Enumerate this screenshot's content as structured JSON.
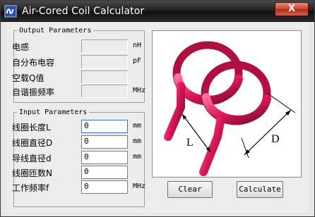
{
  "window": {
    "title": "Air-Cored Coil Calculator",
    "close_label": "X"
  },
  "output": {
    "legend": "Output Parameters",
    "rows": [
      {
        "label": "电感",
        "value": "",
        "unit": "nH"
      },
      {
        "label": "自分布电容",
        "value": "",
        "unit": "pF"
      },
      {
        "label": "空载Q值",
        "value": "",
        "unit": ""
      },
      {
        "label": "自谐振频率",
        "value": "",
        "unit": "MHz"
      }
    ]
  },
  "input": {
    "legend": "Input Parameters",
    "rows": [
      {
        "label": "线圈长度L",
        "value": "0",
        "unit": "mm"
      },
      {
        "label": "线圈直径D",
        "value": "0",
        "unit": "mm"
      },
      {
        "label": "导线直径d",
        "value": "0",
        "unit": "mm"
      },
      {
        "label": "线圈匝数N",
        "value": "0",
        "unit": ""
      },
      {
        "label": "工作频率f",
        "value": "0",
        "unit": "MHz"
      }
    ]
  },
  "diagram": {
    "label_L": "L",
    "label_D": "D",
    "coil_color": "#e0185a"
  },
  "buttons": {
    "clear": "Clear",
    "calculate": "Calculate"
  }
}
